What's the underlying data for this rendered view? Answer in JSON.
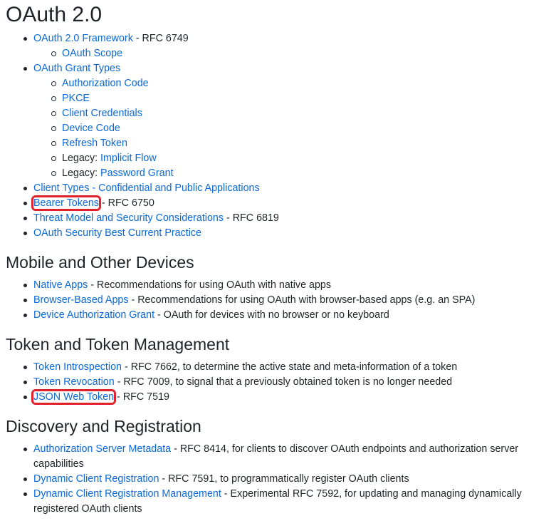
{
  "page_title": "OAuth 2.0",
  "sections": {
    "oauth": {
      "items": [
        {
          "link": "OAuth 2.0 Framework",
          "text": " - RFC 6749"
        },
        {
          "link": "OAuth Scope",
          "text": ""
        },
        {
          "link": "OAuth Grant Types",
          "text": ""
        },
        {
          "link": "Authorization Code",
          "text": ""
        },
        {
          "link": "PKCE",
          "text": ""
        },
        {
          "link": "Client Credentials",
          "text": ""
        },
        {
          "link": "Device Code",
          "text": ""
        },
        {
          "link": "Refresh Token",
          "text": ""
        },
        {
          "prefix": "Legacy: ",
          "link": "Implicit Flow"
        },
        {
          "prefix": "Legacy: ",
          "link": "Password Grant"
        },
        {
          "link": "Client Types - Confidential and Public Applications",
          "text": ""
        },
        {
          "link": "Bearer Tokens",
          "text": " - RFC 6750"
        },
        {
          "link": "Threat Model and Security Considerations",
          "text": " - RFC 6819"
        },
        {
          "link": "OAuth Security Best Current Practice",
          "text": ""
        }
      ]
    },
    "mobile": {
      "heading": "Mobile and Other Devices",
      "items": [
        {
          "link": "Native Apps",
          "text": " - Recommendations for using OAuth with native apps"
        },
        {
          "link": "Browser-Based Apps",
          "text": " - Recommendations for using OAuth with browser-based apps (e.g. an SPA)"
        },
        {
          "link": "Device Authorization Grant",
          "text": " - OAuth for devices with no browser or no keyboard"
        }
      ]
    },
    "token": {
      "heading": "Token and Token Management",
      "items": [
        {
          "link": "Token Introspection",
          "text": " - RFC 7662, to determine the active state and meta-information of a token"
        },
        {
          "link": "Token Revocation",
          "text": " - RFC 7009, to signal that a previously obtained token is no longer needed"
        },
        {
          "link": "JSON Web Token",
          "text": " - RFC 7519"
        }
      ]
    },
    "discovery": {
      "heading": "Discovery and Registration",
      "items": [
        {
          "link": "Authorization Server Metadata",
          "text": " - RFC 8414, for clients to discover OAuth endpoints and authorization server capabilities"
        },
        {
          "link": "Dynamic Client Registration",
          "text": " - RFC 7591, to programmatically register OAuth clients"
        },
        {
          "link": "Dynamic Client Registration Management",
          "text": " - Experimental RFC 7592, for updating and managing dynamically registered OAuth clients"
        }
      ]
    }
  }
}
